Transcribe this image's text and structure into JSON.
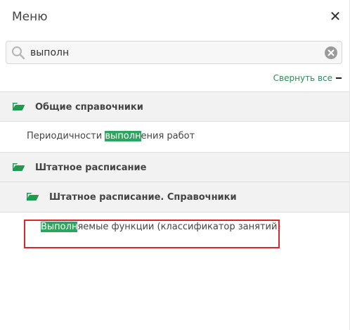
{
  "header": {
    "title": "Меню",
    "close_icon": "close-icon"
  },
  "search": {
    "value": "выполн",
    "placeholder": "",
    "search_icon": "search-icon",
    "clear_icon": "clear-icon"
  },
  "controls": {
    "collapse_all_label": "Свернуть все"
  },
  "tree": {
    "group1": {
      "label": "Общие справочники",
      "icon": "folder-open-icon"
    },
    "item1": {
      "before": "Периодичности ",
      "match": "выполн",
      "after": "ения работ"
    },
    "group2": {
      "label": "Штатное расписание",
      "icon": "folder-open-icon"
    },
    "subgroup1": {
      "label": "Штатное расписание. Справочники",
      "icon": "folder-open-icon"
    },
    "item2": {
      "before": "",
      "match": "Выполн",
      "after": "яемые функции (классификатор занятий)"
    }
  },
  "colors": {
    "highlight": "#2ea55f",
    "accent": "#2e8b57",
    "folder": "#1f9a4f",
    "selection_border": "#d9272e"
  }
}
